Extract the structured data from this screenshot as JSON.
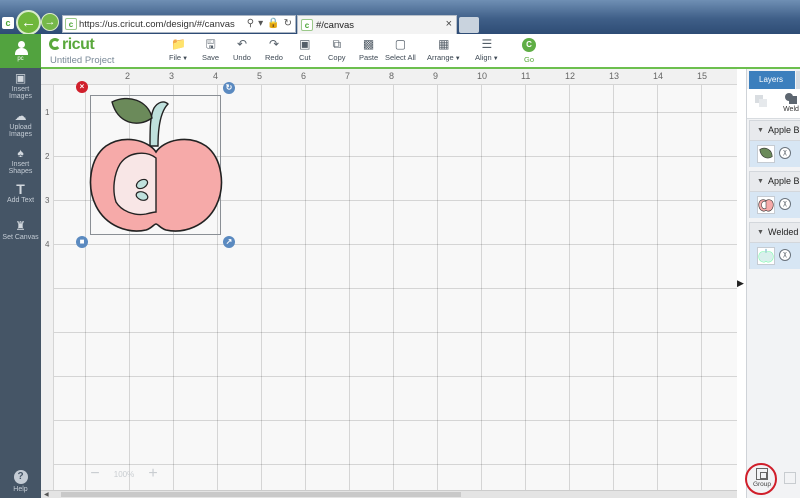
{
  "browser": {
    "back_icon": "arrow-left-icon",
    "forward_icon": "arrow-right-icon",
    "url": "https://us.cricut.com/design/#/canvas",
    "tab_title": "#/canvas",
    "favicon_letter": "c"
  },
  "sidebar": {
    "user_initials": "pc",
    "items": [
      {
        "label": "Insert Images",
        "icon": "image-icon"
      },
      {
        "label": "Upload Images",
        "icon": "cloud-upload-icon"
      },
      {
        "label": "Insert Shapes",
        "icon": "shapes-icon"
      },
      {
        "label": "Add Text",
        "icon": "text-icon"
      },
      {
        "label": "Set Canvas",
        "icon": "shirt-icon"
      }
    ],
    "help_label": "Help"
  },
  "header": {
    "logo": "Cricut",
    "project_name": "Untitled Project",
    "toolbar": {
      "file": "File",
      "save": "Save",
      "undo": "Undo",
      "redo": "Redo",
      "cut": "Cut",
      "copy": "Copy",
      "paste": "Paste",
      "select_all": "Select All",
      "arrange": "Arrange",
      "align": "Align",
      "go": "Go",
      "go_badge": "C"
    }
  },
  "rulers": {
    "top": [
      "2",
      "3",
      "4",
      "5",
      "6",
      "7",
      "8",
      "9",
      "10",
      "11",
      "12",
      "13",
      "14",
      "15"
    ],
    "left": [
      "1",
      "2",
      "3",
      "4"
    ]
  },
  "canvas": {
    "zoom_minus": "−",
    "zoom_level": "100%",
    "zoom_plus": "+"
  },
  "colors": {
    "brand_green": "#5aa83c",
    "apple_pink": "#f6aaa9",
    "leaf_green": "#6b8a5a",
    "stem_blue": "#bfe1dd",
    "delete_red": "#d0202c",
    "handle_blue": "#5b8ac0",
    "layers_tab_blue": "#3c7fbd"
  },
  "layers_panel": {
    "tab_label": "Layers",
    "weld_label": "Weld",
    "groups": [
      {
        "name": "Apple B",
        "thumb": "leaf"
      },
      {
        "name": "Apple B",
        "thumb": "apple"
      },
      {
        "name": "Welded",
        "thumb": "welded"
      }
    ],
    "group_button_label": "Group"
  }
}
